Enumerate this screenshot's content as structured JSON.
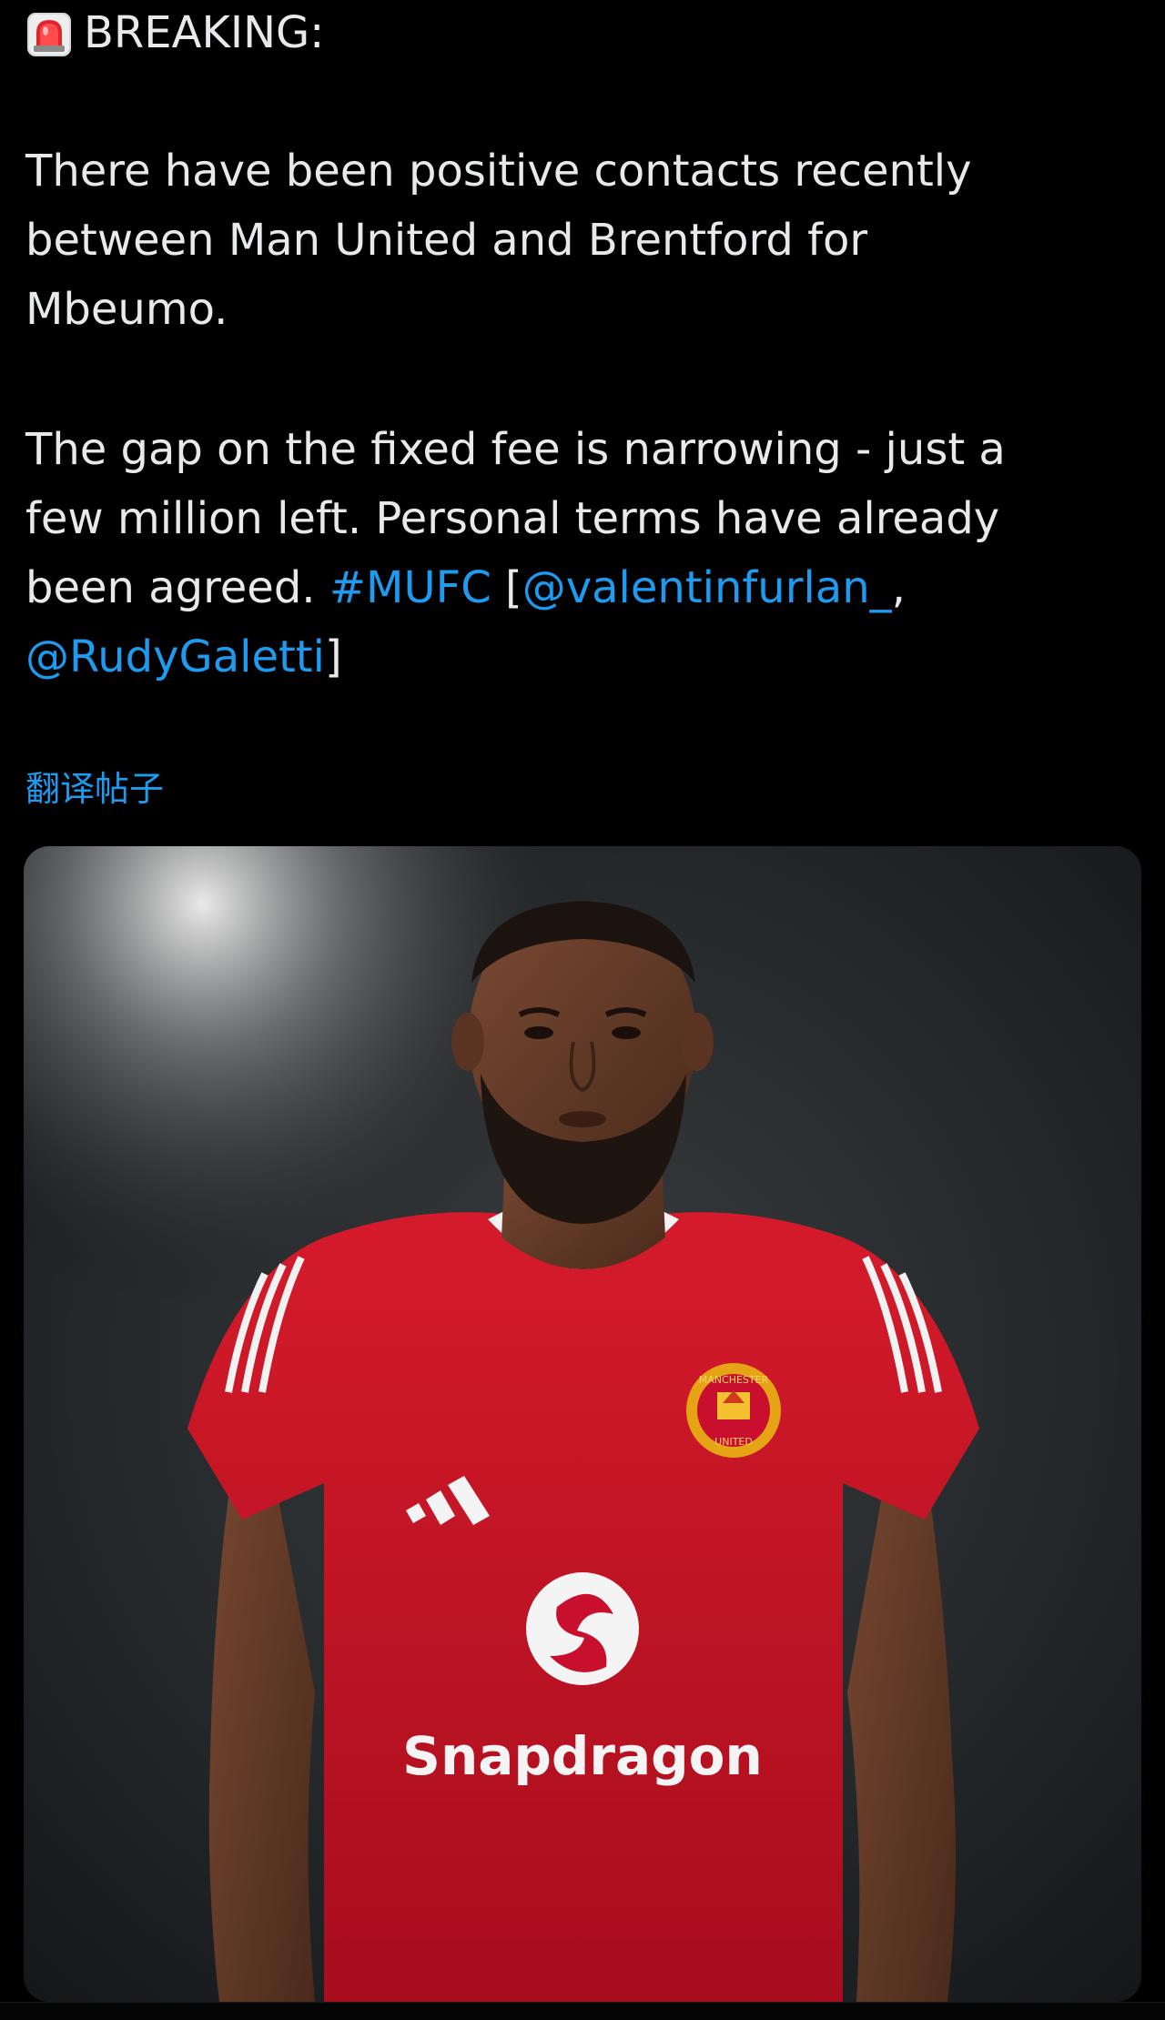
{
  "post": {
    "headline_icon": "siren-icon",
    "headline": "BREAKING:",
    "paragraph1": {
      "line1": "There have been positive contacts recently",
      "line2": "between Man United and Brentford for",
      "line3": "Mbeumo."
    },
    "paragraph2": {
      "line1": "The gap on the fixed fee is narrowing -  just a",
      "line2": "few million left. Personal terms have already",
      "line3_text": "been agreed. ",
      "hashtag": "#MUFC",
      "bracket_open": " [",
      "mention1": "@valentinfurlan_",
      "comma": ",",
      "mention2": "@RudyGaletti",
      "bracket_close": "]"
    },
    "translate_link": "翻译帖子"
  },
  "media": {
    "kind": "photo",
    "shirt_sponsor": "Snapdragon",
    "crest_text_top": "MANCHESTER",
    "crest_text_bottom": "UNITED"
  },
  "colors": {
    "background": "#000000",
    "text": "#e7e9ea",
    "link": "#1d9bf0",
    "shirt_red": "#c8102e"
  }
}
